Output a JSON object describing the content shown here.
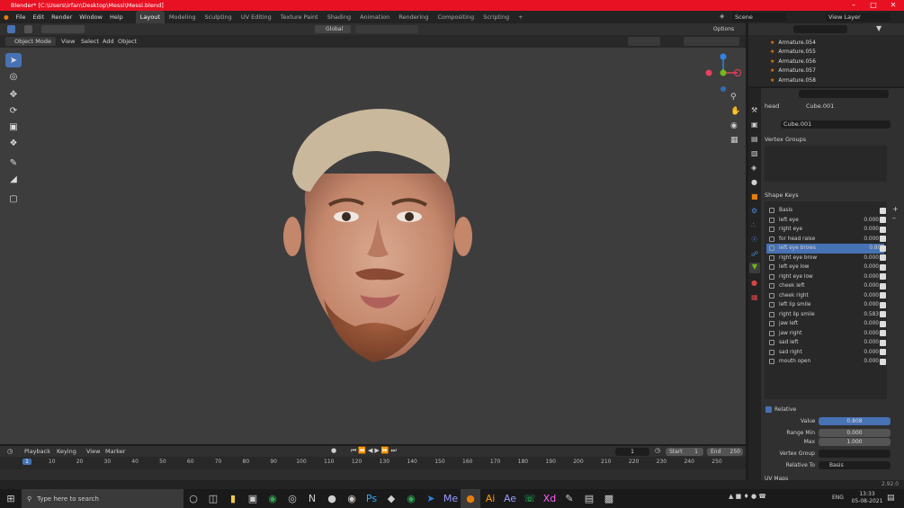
{
  "window": {
    "title": "Blender* [C:\\Users\\irfan\\Desktop\\Messi\\Messi.blend]"
  },
  "menu": [
    "File",
    "Edit",
    "Render",
    "Window",
    "Help"
  ],
  "workspaces": [
    "Layout",
    "Modeling",
    "Sculpting",
    "UV Editing",
    "Texture Paint",
    "Shading",
    "Animation",
    "Rendering",
    "Compositing",
    "Scripting"
  ],
  "scene": {
    "name": "Scene",
    "view_layer": "View Layer"
  },
  "viewport": {
    "mode": "Object Mode",
    "menus": [
      "View",
      "Select",
      "Add",
      "Object"
    ],
    "orientation": "Global",
    "options": "Options"
  },
  "outliner": {
    "items": [
      "Armature.054",
      "Armature.055",
      "Armature.056",
      "Armature.057",
      "Armature.058"
    ]
  },
  "properties": {
    "object": "head",
    "mesh": "Cube.001",
    "data_name": "Cube.001",
    "vertex_groups_label": "Vertex Groups",
    "shape_keys_label": "Shape Keys",
    "shape_keys": [
      {
        "name": "Basis",
        "value": ""
      },
      {
        "name": "left eye",
        "value": "0.000"
      },
      {
        "name": "right eye",
        "value": "0.000"
      },
      {
        "name": "for head raise",
        "value": "0.000"
      },
      {
        "name": "left eye brows",
        "value": "0.808",
        "selected": true
      },
      {
        "name": "right eye brow",
        "value": "0.000"
      },
      {
        "name": "left eye low",
        "value": "0.000"
      },
      {
        "name": "right eye low",
        "value": "0.000"
      },
      {
        "name": "cheek left",
        "value": "0.000"
      },
      {
        "name": "cheek right",
        "value": "0.000"
      },
      {
        "name": "left lip smile",
        "value": "0.000"
      },
      {
        "name": "right lip smile",
        "value": "0.583"
      },
      {
        "name": "jaw left",
        "value": "0.000"
      },
      {
        "name": "jaw right",
        "value": "0.000"
      },
      {
        "name": "sad left",
        "value": "0.000"
      },
      {
        "name": "sad right",
        "value": "0.000"
      },
      {
        "name": "mouth open",
        "value": "0.000"
      }
    ],
    "relative_label": "Relative",
    "value_label": "Value",
    "value": "0.808",
    "range_min_label": "Range Min",
    "range_min": "0.000",
    "max_label": "Max",
    "max": "1.000",
    "vertex_group_label": "Vertex Group",
    "relative_to_label": "Relative To",
    "relative_to": "Basis",
    "uv_maps_label": "UV Maps"
  },
  "timeline": {
    "menus": [
      "Playback",
      "Keying",
      "View",
      "Marker"
    ],
    "current_frame": "1",
    "start_label": "Start",
    "start": "1",
    "end_label": "End",
    "end": "250",
    "ticks": [
      "1",
      "10",
      "20",
      "30",
      "40",
      "50",
      "60",
      "70",
      "80",
      "90",
      "100",
      "110",
      "120",
      "130",
      "140",
      "150",
      "160",
      "170",
      "180",
      "190",
      "200",
      "210",
      "220",
      "230",
      "240",
      "250"
    ]
  },
  "status": {
    "version": "2.92.0"
  },
  "taskbar": {
    "search_placeholder": "Type here to search",
    "time": "13:33",
    "date": "05-08-2021",
    "lang": "ENG"
  }
}
